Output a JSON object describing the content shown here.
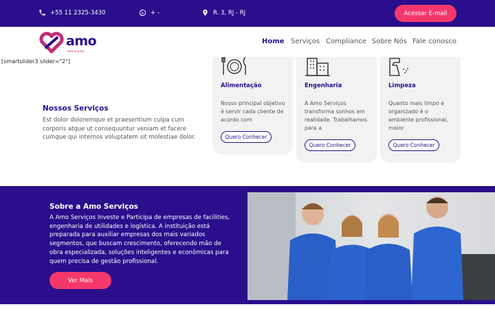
{
  "topbar": {
    "phone": "+55 11 2325-3430",
    "whatsapp": "+ -",
    "address": "R. 3, RJ - RJ",
    "access_button": "Acessar E-mail"
  },
  "brand": {
    "name": "amo",
    "tagline": "serviços"
  },
  "nav": {
    "items": [
      "Home",
      "Serviços",
      "Compliance",
      "Sobre Nós",
      "Fale conosco"
    ]
  },
  "shortcode": "[smartslider3 slider=\"2\"]",
  "services": {
    "title": "Nossos Serviços",
    "description": "Est dolor doloremque et praesentium culpa cum corporis atque ut consequuntur veniam et facere cumque qui internos voluptatem sit molestiae dolor.",
    "cards": [
      {
        "title": "Alimentação",
        "text": "Nosso principal objetivo é servir cada cliente de acordo com",
        "button": "Quero Conhecer",
        "icon": "food-plate-icon"
      },
      {
        "title": "Engenharia",
        "text": "A Amo Serviços transforma sonhos em realidade. Trabalhamos para a",
        "button": "Quero Conhecer",
        "icon": "building-icon"
      },
      {
        "title": "Limpeza",
        "text": "Quanto mais limpo e organizado é o ambiente profissional, maior",
        "button": "Quero Conhecer",
        "icon": "spray-bottle-icon"
      }
    ]
  },
  "about": {
    "title": "Sobre a Amo Serviços",
    "text": "A Amo Serviços Investe e Participa de empresas de facilities, engenharia de utilidades e logística. A instituição está preparada para auxiliar empresas dos mais variados segmentos, que buscam crescimento, oferecendo mão de obra especializada, soluções inteligentes e econômicas para quem precisa de gestão profissional.",
    "button": "Ver Mais"
  },
  "colors": {
    "primary": "#2a0e8c",
    "accent": "#f5386b",
    "card_bg": "#f2f2f2"
  }
}
